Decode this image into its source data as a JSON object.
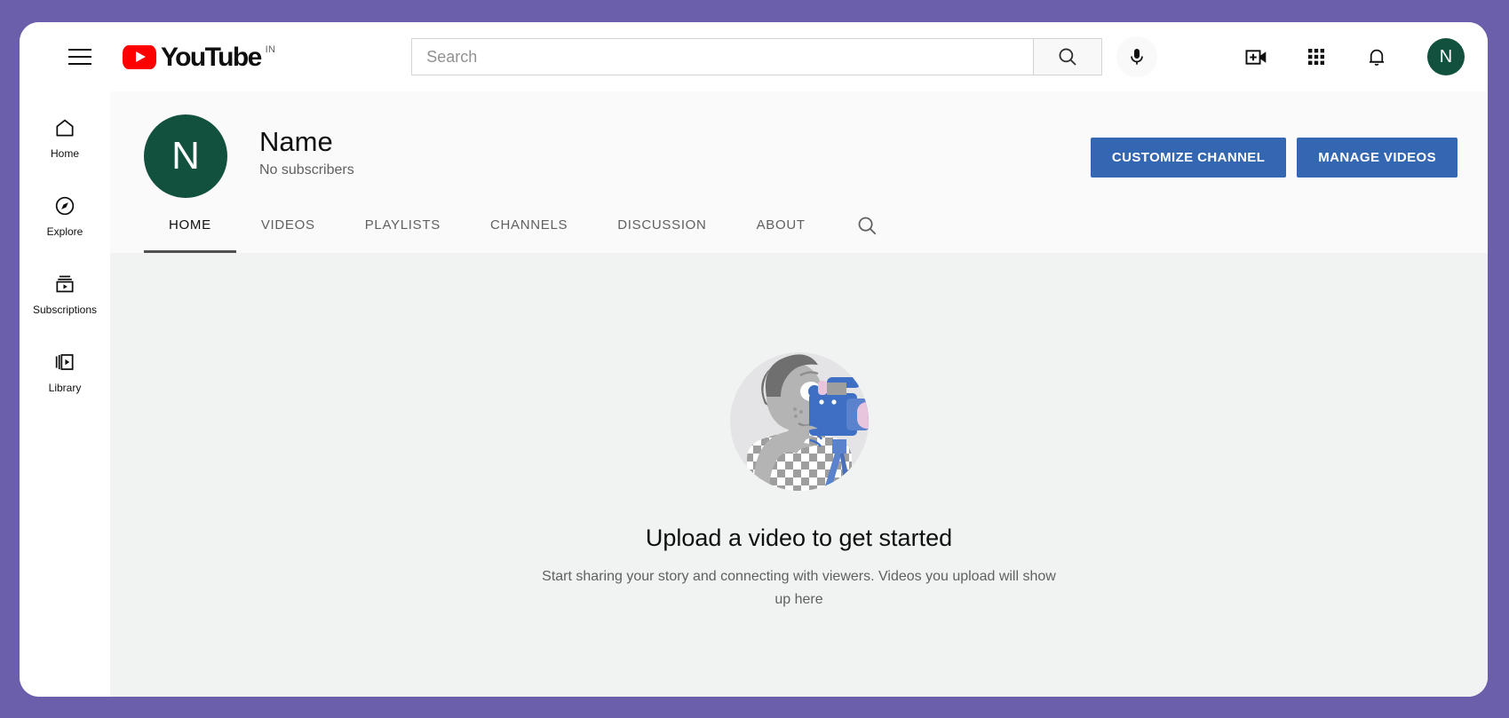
{
  "masthead": {
    "menu_icon": "hamburger-menu-icon",
    "logo_text": "YouTube",
    "logo_country": "IN",
    "search": {
      "placeholder": "Search",
      "value": "",
      "button_icon": "search-icon"
    },
    "mic_icon": "microphone-icon",
    "actions": [
      {
        "name": "create-video",
        "icon": "create-video-icon"
      },
      {
        "name": "apps",
        "icon": "apps-grid-icon"
      },
      {
        "name": "notifications",
        "icon": "bell-icon"
      }
    ],
    "avatar_letter": "N"
  },
  "sidebar": {
    "items": [
      {
        "label": "Home",
        "icon": "home-icon"
      },
      {
        "label": "Explore",
        "icon": "compass-icon"
      },
      {
        "label": "Subscriptions",
        "icon": "subscriptions-icon"
      },
      {
        "label": "Library",
        "icon": "library-icon"
      }
    ]
  },
  "channel": {
    "avatar_letter": "N",
    "name": "Name",
    "subscribers": "No subscribers",
    "actions": [
      {
        "label": "CUSTOMIZE CHANNEL"
      },
      {
        "label": "MANAGE VIDEOS"
      }
    ],
    "tabs": [
      {
        "label": "HOME",
        "active": true
      },
      {
        "label": "VIDEOS",
        "active": false
      },
      {
        "label": "PLAYLISTS",
        "active": false
      },
      {
        "label": "CHANNELS",
        "active": false
      },
      {
        "label": "DISCUSSION",
        "active": false
      },
      {
        "label": "ABOUT",
        "active": false
      }
    ],
    "tab_search_icon": "search-icon"
  },
  "empty_state": {
    "illustration": "person-filming-with-camcorder-illustration",
    "title": "Upload a video to get started",
    "description": "Start sharing your story and connecting with viewers. Videos you upload will show up here"
  },
  "colors": {
    "desktop_background": "#6b5fab",
    "brand_red": "#ff0000",
    "accent_blue": "#3367b1",
    "avatar_green": "#13513f",
    "content_background": "#f1f3f3"
  }
}
